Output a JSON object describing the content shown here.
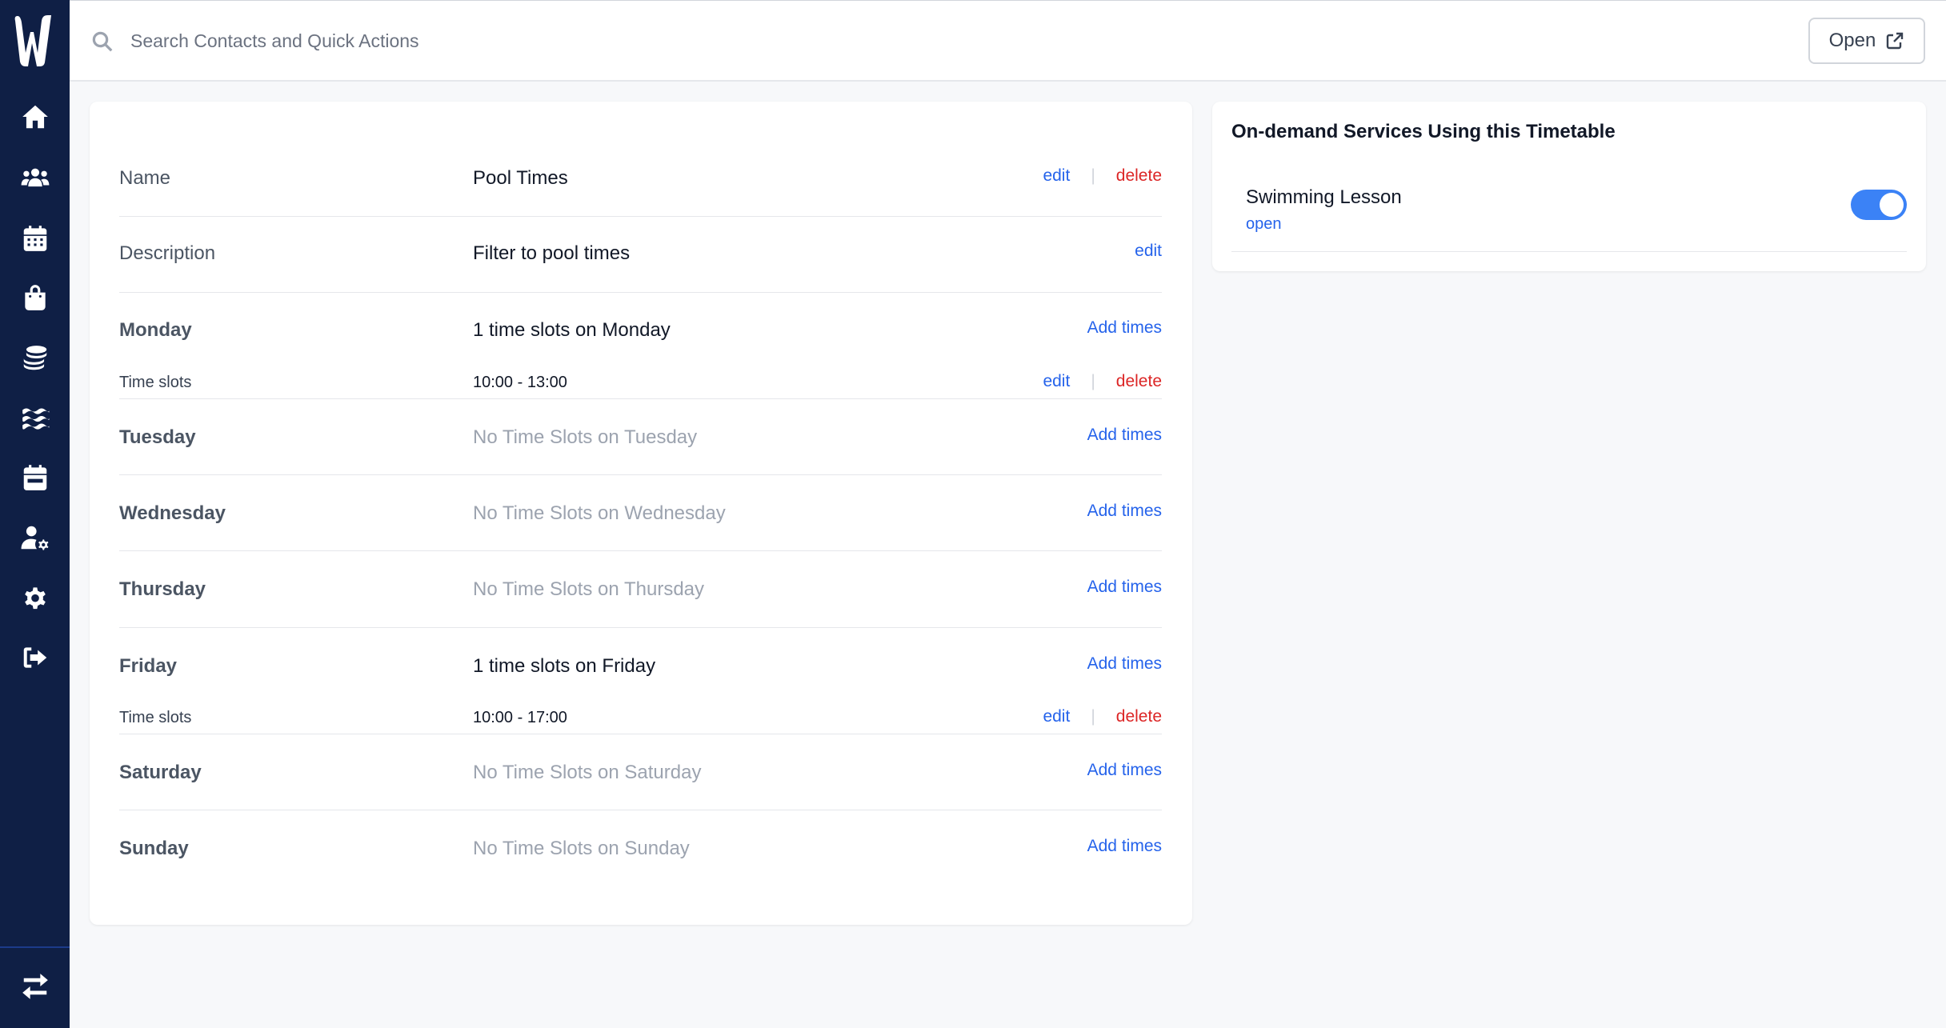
{
  "search": {
    "placeholder": "Search Contacts and Quick Actions"
  },
  "header": {
    "open_label": "Open"
  },
  "timetable": {
    "name": {
      "label": "Name",
      "value": "Pool Times",
      "edit": "edit",
      "delete": "delete"
    },
    "description": {
      "label": "Description",
      "value": "Filter to pool times",
      "edit": "edit"
    },
    "add_times_label": "Add times",
    "days": [
      {
        "label": "Monday",
        "summary": "1 time slots on Monday",
        "slots_label": "Time slots",
        "slot": "10:00 - 13:00",
        "edit": "edit",
        "delete": "delete"
      },
      {
        "label": "Tuesday",
        "summary": "No Time Slots on Tuesday"
      },
      {
        "label": "Wednesday",
        "summary": "No Time Slots on Wednesday"
      },
      {
        "label": "Thursday",
        "summary": "No Time Slots on Thursday"
      },
      {
        "label": "Friday",
        "summary": "1 time slots on Friday",
        "slots_label": "Time slots",
        "slot": "10:00 - 17:00",
        "edit": "edit",
        "delete": "delete"
      },
      {
        "label": "Saturday",
        "summary": "No Time Slots on Saturday"
      },
      {
        "label": "Sunday",
        "summary": "No Time Slots on Sunday"
      }
    ]
  },
  "services": {
    "title": "On-demand Services Using this Timetable",
    "items": [
      {
        "name": "Swimming Lesson",
        "open": "open",
        "enabled": true
      }
    ]
  },
  "colors": {
    "sidebar": "#0f1f45",
    "link": "#2563eb",
    "danger": "#dc2626",
    "toggle_on": "#3b82f6"
  },
  "icons": [
    "home-icon",
    "users-icon",
    "calendar-icon",
    "shopping-bag-icon",
    "coins-icon",
    "water-icon",
    "calendar-day-icon",
    "user-gear-icon",
    "gear-icon",
    "sign-out-icon",
    "exchange-icon"
  ]
}
